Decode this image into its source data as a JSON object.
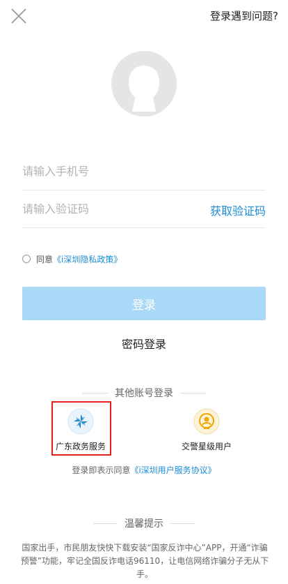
{
  "header": {
    "help_text": "登录遇到问题?"
  },
  "form": {
    "phone_placeholder": "请输入手机号",
    "code_placeholder": "请输入验证码",
    "get_code_label": "获取验证码"
  },
  "agreement": {
    "prefix": "同意",
    "policy_link": "《i深圳隐私政策》"
  },
  "login_button": "登录",
  "password_login": "密码登录",
  "other_login": {
    "title": "其他账号登录",
    "providers": [
      {
        "label": "广东政务服务",
        "icon": "guangdong-gov-icon",
        "color": "#1a7fc4"
      },
      {
        "label": "交警星级用户",
        "icon": "traffic-police-icon",
        "color": "#f0a500"
      }
    ]
  },
  "terms": {
    "prefix": "登录即表示同意",
    "link": "《i深圳用户服务协议》"
  },
  "tips": {
    "title": "温馨提示",
    "body": "国家出手，市民朋友快快下载安装“国家反诈中心”APP，开通“诈骗预警”功能，牢记全国反诈电话96110，让电信网络诈骗分子无从下手。"
  },
  "colors": {
    "accent": "#1a8cd8",
    "login_button_bg": "#aad8f7",
    "highlight": "#e02020"
  }
}
